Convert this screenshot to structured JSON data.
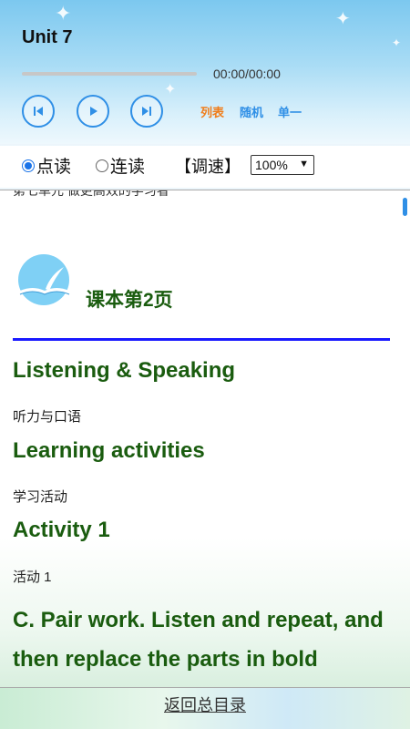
{
  "header": {
    "title": "Unit 7",
    "progress_fraction": 0,
    "time": "00:00/00:00",
    "modes": [
      {
        "label": "列表",
        "color": "#f07d1a"
      },
      {
        "label": "随机",
        "color": "#2f8fe6"
      },
      {
        "label": "单一",
        "color": "#2f8fe6"
      }
    ]
  },
  "options": {
    "mode_point": "点读",
    "mode_continuous": "连读",
    "selected_mode": "点读",
    "speed_label": "【调速】",
    "speed_value": "100%"
  },
  "content": {
    "cut_text": "第七单元 做更高效的学习者",
    "page_label": "课本第2页",
    "sections": [
      {
        "en": "Listening & Speaking",
        "cn": "听力与口语"
      },
      {
        "en": "Learning activities",
        "cn": "学习活动"
      },
      {
        "en": "Activity 1",
        "cn": "活动 1"
      }
    ],
    "instruction": "C. Pair work. Listen and repeat, and then replace the parts in bold"
  },
  "footer": {
    "back_link": "返回总目录"
  },
  "colors": {
    "heading_green": "#1a5c0f",
    "accent_blue": "#2f8fe6",
    "divider_blue": "#1a1aff"
  }
}
